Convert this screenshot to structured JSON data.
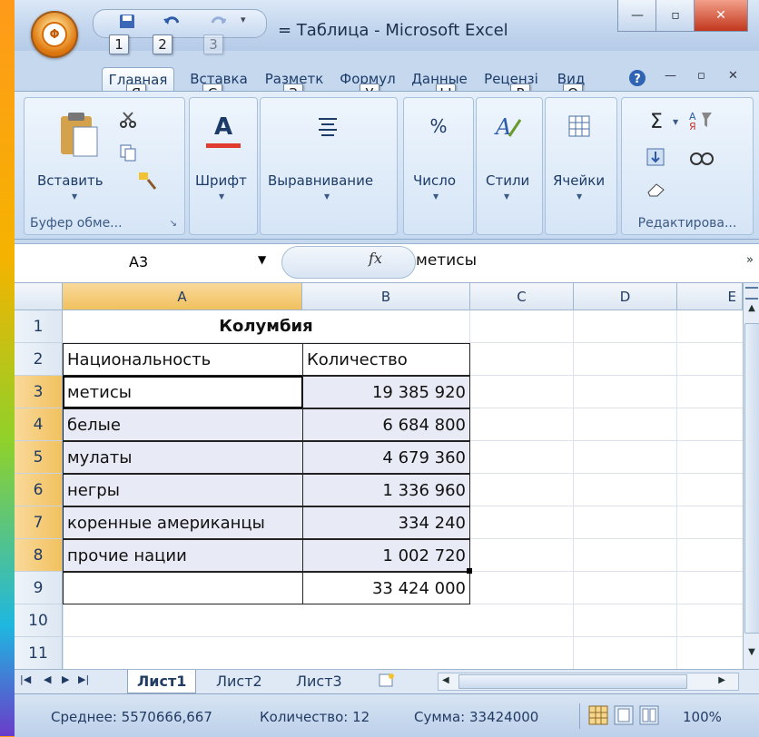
{
  "window": {
    "title": "= Таблица - Microsoft Excel"
  },
  "qat_keytips": [
    "1",
    "2",
    "3"
  ],
  "tabs": [
    {
      "label": "Главная",
      "keytip": "Я"
    },
    {
      "label": "Вставка",
      "keytip": "С"
    },
    {
      "label": "Разметк",
      "keytip": "З"
    },
    {
      "label": "Формул",
      "keytip": "У"
    },
    {
      "label": "Данные",
      "keytip": "Ы"
    },
    {
      "label": "Рецензі",
      "keytip": "Р"
    },
    {
      "label": "Вид",
      "keytip": "О"
    }
  ],
  "ribbon": {
    "paste_label": "Вставить",
    "clipboard_label": "Буфер обме...",
    "font_label": "Шрифт",
    "align_label": "Выравнивание",
    "number_label": "Число",
    "styles_label": "Стили",
    "cells_label": "Ячейки",
    "editing_label": "Редактирова...",
    "percent_glyph": "%",
    "font_glyph": "A",
    "sigma_glyph": "Σ"
  },
  "formula_bar": {
    "name_box": "A3",
    "fx": "fx",
    "value": "метисы"
  },
  "columns": [
    "A",
    "B",
    "C",
    "D",
    "E"
  ],
  "rows": [
    "1",
    "2",
    "3",
    "4",
    "5",
    "6",
    "7",
    "8",
    "9",
    "10",
    "11"
  ],
  "sheet": {
    "title": "Колумбия",
    "header_a": "Национальность",
    "header_b": "Количество",
    "data": [
      {
        "name": "метисы",
        "value": "19 385 920"
      },
      {
        "name": "белые",
        "value": "6 684 800"
      },
      {
        "name": "мулаты",
        "value": "4 679 360"
      },
      {
        "name": "негры",
        "value": "1 336 960"
      },
      {
        "name": "коренные американцы",
        "value": "334 240"
      },
      {
        "name": "прочие нации",
        "value": "1 002 720"
      }
    ],
    "total": "33 424 000"
  },
  "sheet_tabs": [
    "Лист1",
    "Лист2",
    "Лист3"
  ],
  "status": {
    "average": "Среднее: 5570666,667",
    "count": "Количество: 12",
    "sum": "Сумма: 33424000",
    "zoom": "100%"
  }
}
